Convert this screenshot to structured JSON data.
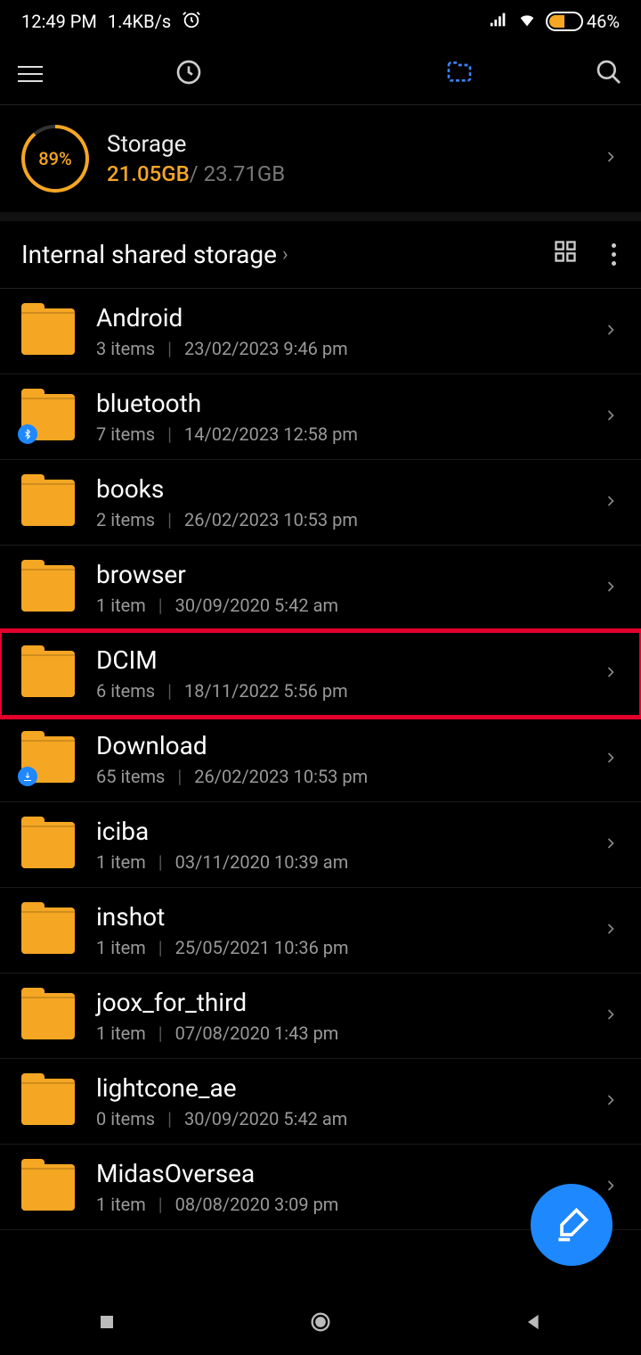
{
  "status": {
    "time": "12:49 PM",
    "speed": "1.4KB/s",
    "battery_pct": "46%"
  },
  "storage": {
    "title": "Storage",
    "percent_label": "89%",
    "used": "21.05GB",
    "total": "23.71GB"
  },
  "breadcrumb": {
    "path": "Internal shared storage"
  },
  "folders": [
    {
      "name": "Android",
      "items": "3 items",
      "date": "23/02/2023 9:46 pm",
      "badge": null,
      "highlight": false
    },
    {
      "name": "bluetooth",
      "items": "7 items",
      "date": "14/02/2023 12:58 pm",
      "badge": "bt",
      "highlight": false
    },
    {
      "name": "books",
      "items": "2 items",
      "date": "26/02/2023 10:53 pm",
      "badge": null,
      "highlight": false
    },
    {
      "name": "browser",
      "items": "1 item",
      "date": "30/09/2020 5:42 am",
      "badge": null,
      "highlight": false
    },
    {
      "name": "DCIM",
      "items": "6 items",
      "date": "18/11/2022 5:56 pm",
      "badge": null,
      "highlight": true
    },
    {
      "name": "Download",
      "items": "65 items",
      "date": "26/02/2023 10:53 pm",
      "badge": "dl",
      "highlight": false
    },
    {
      "name": "iciba",
      "items": "1 item",
      "date": "03/11/2020 10:39 am",
      "badge": null,
      "highlight": false
    },
    {
      "name": "inshot",
      "items": "1 item",
      "date": "25/05/2021 10:36 pm",
      "badge": null,
      "highlight": false
    },
    {
      "name": "joox_for_third",
      "items": "1 item",
      "date": "07/08/2020 1:43 pm",
      "badge": null,
      "highlight": false
    },
    {
      "name": "lightcone_ae",
      "items": "0 items",
      "date": "30/09/2020 5:42 am",
      "badge": null,
      "highlight": false
    },
    {
      "name": "MidasOversea",
      "items": "1 item",
      "date": "08/08/2020 3:09 pm",
      "badge": null,
      "highlight": false
    }
  ]
}
